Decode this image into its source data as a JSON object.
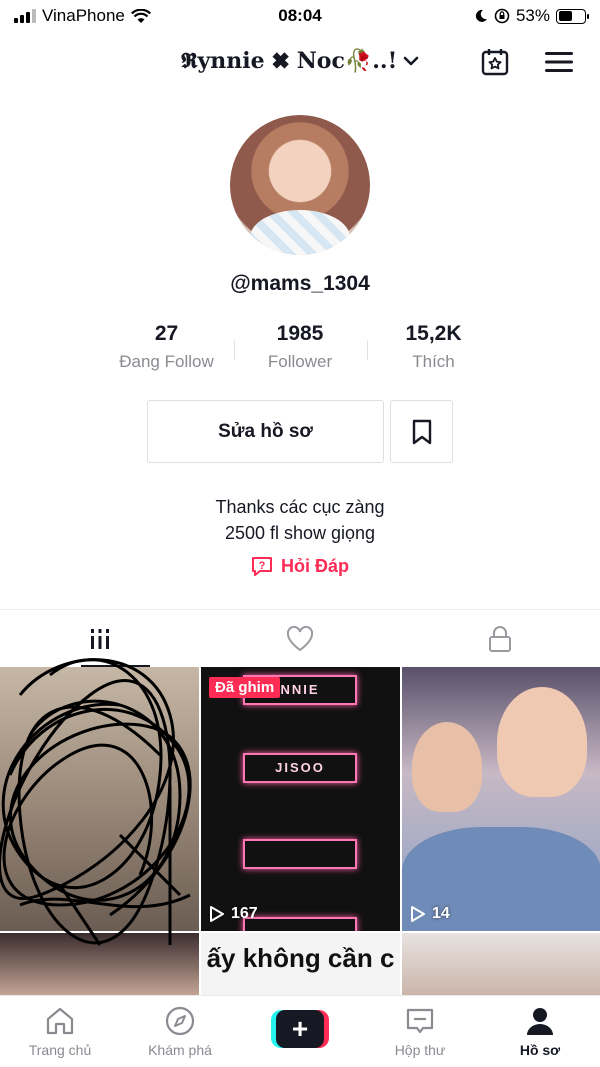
{
  "status_bar": {
    "carrier": "VinaPhone",
    "time": "08:04",
    "battery_percent": "53%",
    "battery_level": 0.53
  },
  "header": {
    "title": "𝕽ynnie ✖ Noc🥀..!",
    "icons": [
      "chevron-down-icon",
      "calendar-star-icon",
      "hamburger-menu-icon"
    ]
  },
  "profile": {
    "username": "@mams_1304",
    "stats": [
      {
        "value": "27",
        "label": "Đang Follow"
      },
      {
        "value": "1985",
        "label": "Follower"
      },
      {
        "value": "15,2K",
        "label": "Thích"
      }
    ],
    "edit_button": "Sửa hồ sơ",
    "bio_lines": [
      "Thanks các cục zàng",
      "2500 fl show giọng"
    ],
    "qa_link": "Hỏi Đáp"
  },
  "tabs": [
    "videos-grid-icon",
    "liked-heart-icon",
    "private-lock-icon"
  ],
  "videos": [
    {
      "pinned": "",
      "plays": ""
    },
    {
      "pinned": "Đã ghim",
      "plays": "167",
      "neon_labels": [
        "NNIE",
        "JISOO",
        "",
        ""
      ]
    },
    {
      "pinned": "",
      "plays": "14"
    },
    {
      "pinned": "",
      "plays": ""
    },
    {
      "pinned": "",
      "plays": "",
      "overlay_text": "ấy không cần c"
    },
    {
      "pinned": "",
      "plays": ""
    }
  ],
  "bottom_nav": [
    {
      "label": "Trang chủ",
      "icon": "home-icon"
    },
    {
      "label": "Khám phá",
      "icon": "compass-icon"
    },
    {
      "label": "",
      "icon": "plus-icon"
    },
    {
      "label": "Hộp thư",
      "icon": "inbox-icon"
    },
    {
      "label": "Hồ sơ",
      "icon": "profile-icon"
    }
  ],
  "colors": {
    "accent": "#fe2c55",
    "cyan": "#25f4ee",
    "text": "#161823",
    "muted": "#8a8b91"
  }
}
